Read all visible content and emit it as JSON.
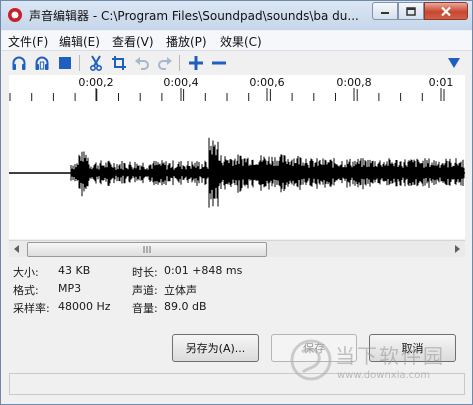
{
  "window": {
    "title": "声音编辑器 - C:\\Program Files\\Soundpad\\sounds\\ba du..."
  },
  "menu": {
    "items": [
      "文件(F)",
      "编辑(E)",
      "查看(V)",
      "播放(P)",
      "效果(C)"
    ]
  },
  "toolbar": {
    "icons": [
      "headphones-icon",
      "headphones-selection-icon",
      "stop-icon",
      "cut-icon",
      "crop-icon",
      "undo-icon",
      "redo-icon",
      "zoom-in-icon",
      "zoom-out-icon",
      "dropdown-arrow-icon"
    ]
  },
  "timeline": {
    "labels": [
      "0:00,2",
      "0:00,4",
      "0:00,6",
      "0:00,8",
      "0:01"
    ]
  },
  "info": {
    "size_label": "大小:",
    "size_value": "43 KB",
    "format_label": "格式:",
    "format_value": "MP3",
    "samplerate_label": "采样率:",
    "samplerate_value": "48000 Hz",
    "duration_label": "时长:",
    "duration_value": "0:01 +848 ms",
    "channels_label": "声道:",
    "channels_value": "立体声",
    "volume_label": "音量:",
    "volume_value": "89.0 dB"
  },
  "buttons": {
    "save_as": "另存为(A)...",
    "save": "保存",
    "cancel": "取消"
  },
  "watermark": {
    "text": "当下软件园",
    "url": "www.downxia.com"
  },
  "colors": {
    "accent": "#1f5fbf",
    "waveform": "#000000",
    "logo_red": "#c8202b"
  }
}
